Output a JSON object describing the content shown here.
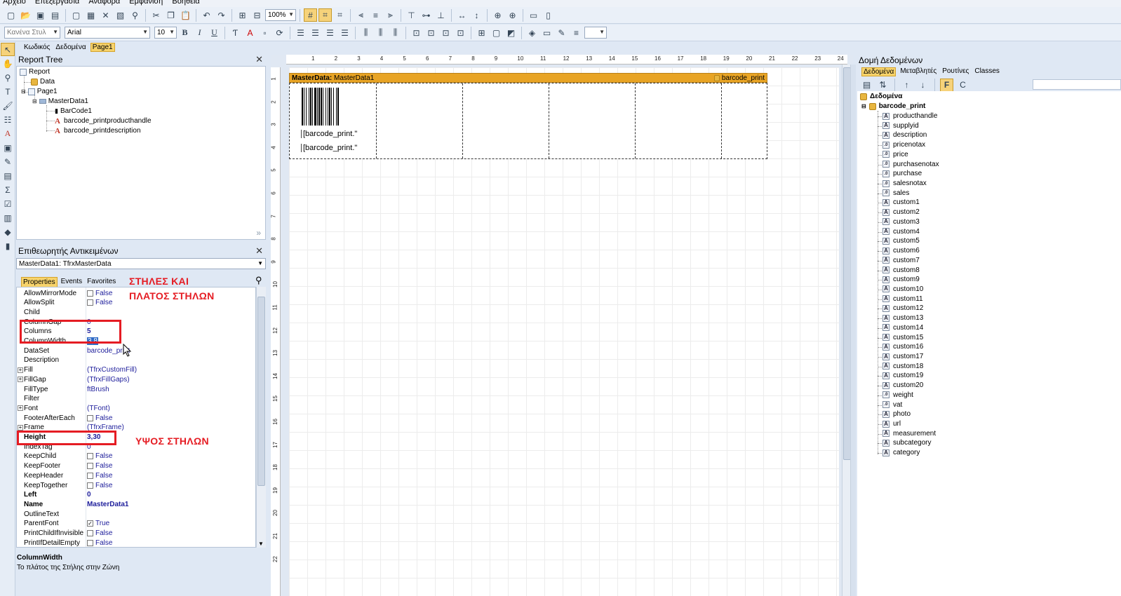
{
  "menu": [
    "Αρχείο",
    "Επεξεργασία",
    "Αναφορά",
    "Εμφάνιση",
    "Βοήθεια"
  ],
  "toolbar": {
    "zoom": "100%",
    "style": "Κανένα Στυλ",
    "font": "Arial",
    "font_size": "10"
  },
  "design_tabs": [
    "Κωδικός",
    "Δεδομένα",
    "Page1"
  ],
  "report_tree": {
    "title": "Report Tree",
    "items": [
      "Report",
      "Data",
      "Page1",
      "MasterData1",
      "BarCode1",
      "barcode_printproducthandle",
      "barcode_printdescription"
    ]
  },
  "inspector": {
    "title": "Επιθεωρητής Αντικειμένων",
    "selected_object": "MasterData1: TfrxMasterData",
    "tabs": [
      "Properties",
      "Events",
      "Favorites"
    ],
    "rows": [
      {
        "name": "AllowMirrorMode",
        "value": "False",
        "check": true,
        "checked": false
      },
      {
        "name": "AllowSplit",
        "value": "False",
        "check": true,
        "checked": false
      },
      {
        "name": "Child",
        "value": ""
      },
      {
        "name": "ColumnGap",
        "value": "0"
      },
      {
        "name": "Columns",
        "value": "5"
      },
      {
        "name": "ColumnWidth",
        "value": "3,8"
      },
      {
        "name": "DataSet",
        "value": "barcode_print"
      },
      {
        "name": "Description",
        "value": ""
      },
      {
        "name": "Fill",
        "value": "(TfrxCustomFill)",
        "expand": true
      },
      {
        "name": "FillGap",
        "value": "(TfrxFillGaps)",
        "expand": true
      },
      {
        "name": "FillType",
        "value": "ftBrush"
      },
      {
        "name": "Filter",
        "value": ""
      },
      {
        "name": "Font",
        "value": "(TFont)",
        "expand": true
      },
      {
        "name": "FooterAfterEach",
        "value": "False",
        "check": true,
        "checked": false
      },
      {
        "name": "Frame",
        "value": "(TfrxFrame)",
        "expand": true
      },
      {
        "name": "Height",
        "value": "3,30",
        "bold": true
      },
      {
        "name": "IndexTag",
        "value": "0"
      },
      {
        "name": "KeepChild",
        "value": "False",
        "check": true,
        "checked": false
      },
      {
        "name": "KeepFooter",
        "value": "False",
        "check": true,
        "checked": false
      },
      {
        "name": "KeepHeader",
        "value": "False",
        "check": true,
        "checked": false
      },
      {
        "name": "KeepTogether",
        "value": "False",
        "check": true,
        "checked": false
      },
      {
        "name": "Left",
        "value": "0",
        "bold": true
      },
      {
        "name": "Name",
        "value": "MasterData1",
        "bold": true
      },
      {
        "name": "OutlineText",
        "value": ""
      },
      {
        "name": "ParentFont",
        "value": "True",
        "check": true,
        "checked": true
      },
      {
        "name": "PrintChildIfInvisible",
        "value": "False",
        "check": true,
        "checked": false
      },
      {
        "name": "PrintIfDetailEmpty",
        "value": "False",
        "check": true,
        "checked": false
      }
    ],
    "help_name": "ColumnWidth",
    "help_text": "Το πλάτος της Στήλης στην Ζώνη"
  },
  "annotations": {
    "columns_line1": "ΣΤΗΛΕΣ ΚΑΙ",
    "columns_line2": "ΠΛΑΤΟΣ ΣΤΗΛΩΝ",
    "height": "ΥΨΟΣ ΣΤΗΛΩΝ",
    "color": "#e51c23"
  },
  "design": {
    "band_label": "MasterData:",
    "band_name": "MasterData1",
    "band_dataset": "barcode_print",
    "memo1": "[barcode_print.\"",
    "memo2": "[barcode_print.\"",
    "hruler": [
      "1",
      "2",
      "3",
      "4",
      "5",
      "6",
      "7",
      "8",
      "9",
      "10",
      "11",
      "12",
      "13",
      "14",
      "15",
      "16",
      "17",
      "18",
      "19",
      "20",
      "21",
      "22",
      "23",
      "24"
    ],
    "vruler": [
      "1",
      "2",
      "3",
      "4",
      "5",
      "6",
      "7",
      "8",
      "9",
      "10",
      "11",
      "12",
      "13",
      "14",
      "15",
      "16",
      "17",
      "18",
      "19",
      "20",
      "21",
      "22"
    ]
  },
  "data_panel": {
    "title": "Δομή Δεδομένων",
    "tabs": [
      "Δεδομένα",
      "Μεταβλητές",
      "Ρουτίνες",
      "Classes"
    ],
    "root": "Δεδομένα",
    "dataset": "barcode_print",
    "fields": [
      {
        "name": "producthandle",
        "type": "A"
      },
      {
        "name": "supplyid",
        "type": "A"
      },
      {
        "name": "description",
        "type": "A"
      },
      {
        "name": "pricenotax",
        "type": "n"
      },
      {
        "name": "price",
        "type": "n"
      },
      {
        "name": "purchasenotax",
        "type": "n"
      },
      {
        "name": "purchase",
        "type": "n"
      },
      {
        "name": "salesnotax",
        "type": "n"
      },
      {
        "name": "sales",
        "type": "n"
      },
      {
        "name": "custom1",
        "type": "A"
      },
      {
        "name": "custom2",
        "type": "A"
      },
      {
        "name": "custom3",
        "type": "A"
      },
      {
        "name": "custom4",
        "type": "A"
      },
      {
        "name": "custom5",
        "type": "A"
      },
      {
        "name": "custom6",
        "type": "A"
      },
      {
        "name": "custom7",
        "type": "A"
      },
      {
        "name": "custom8",
        "type": "A"
      },
      {
        "name": "custom9",
        "type": "A"
      },
      {
        "name": "custom10",
        "type": "A"
      },
      {
        "name": "custom11",
        "type": "A"
      },
      {
        "name": "custom12",
        "type": "A"
      },
      {
        "name": "custom13",
        "type": "A"
      },
      {
        "name": "custom14",
        "type": "A"
      },
      {
        "name": "custom15",
        "type": "A"
      },
      {
        "name": "custom16",
        "type": "A"
      },
      {
        "name": "custom17",
        "type": "A"
      },
      {
        "name": "custom18",
        "type": "A"
      },
      {
        "name": "custom19",
        "type": "A"
      },
      {
        "name": "custom20",
        "type": "A"
      },
      {
        "name": "weight",
        "type": "n"
      },
      {
        "name": "vat",
        "type": "n"
      },
      {
        "name": "photo",
        "type": "A"
      },
      {
        "name": "url",
        "type": "A"
      },
      {
        "name": "measurement",
        "type": "A"
      },
      {
        "name": "subcategory",
        "type": "A"
      },
      {
        "name": "category",
        "type": "A"
      }
    ]
  }
}
